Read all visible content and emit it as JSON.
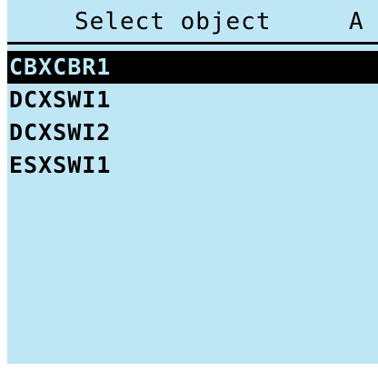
{
  "header": {
    "title": "Select object",
    "indicator": "A"
  },
  "list": {
    "selected_index": 0,
    "items": [
      {
        "label": "CBXCBR1"
      },
      {
        "label": "DCXSWI1"
      },
      {
        "label": "DCXSWI2"
      },
      {
        "label": "ESXSWI1"
      }
    ]
  }
}
